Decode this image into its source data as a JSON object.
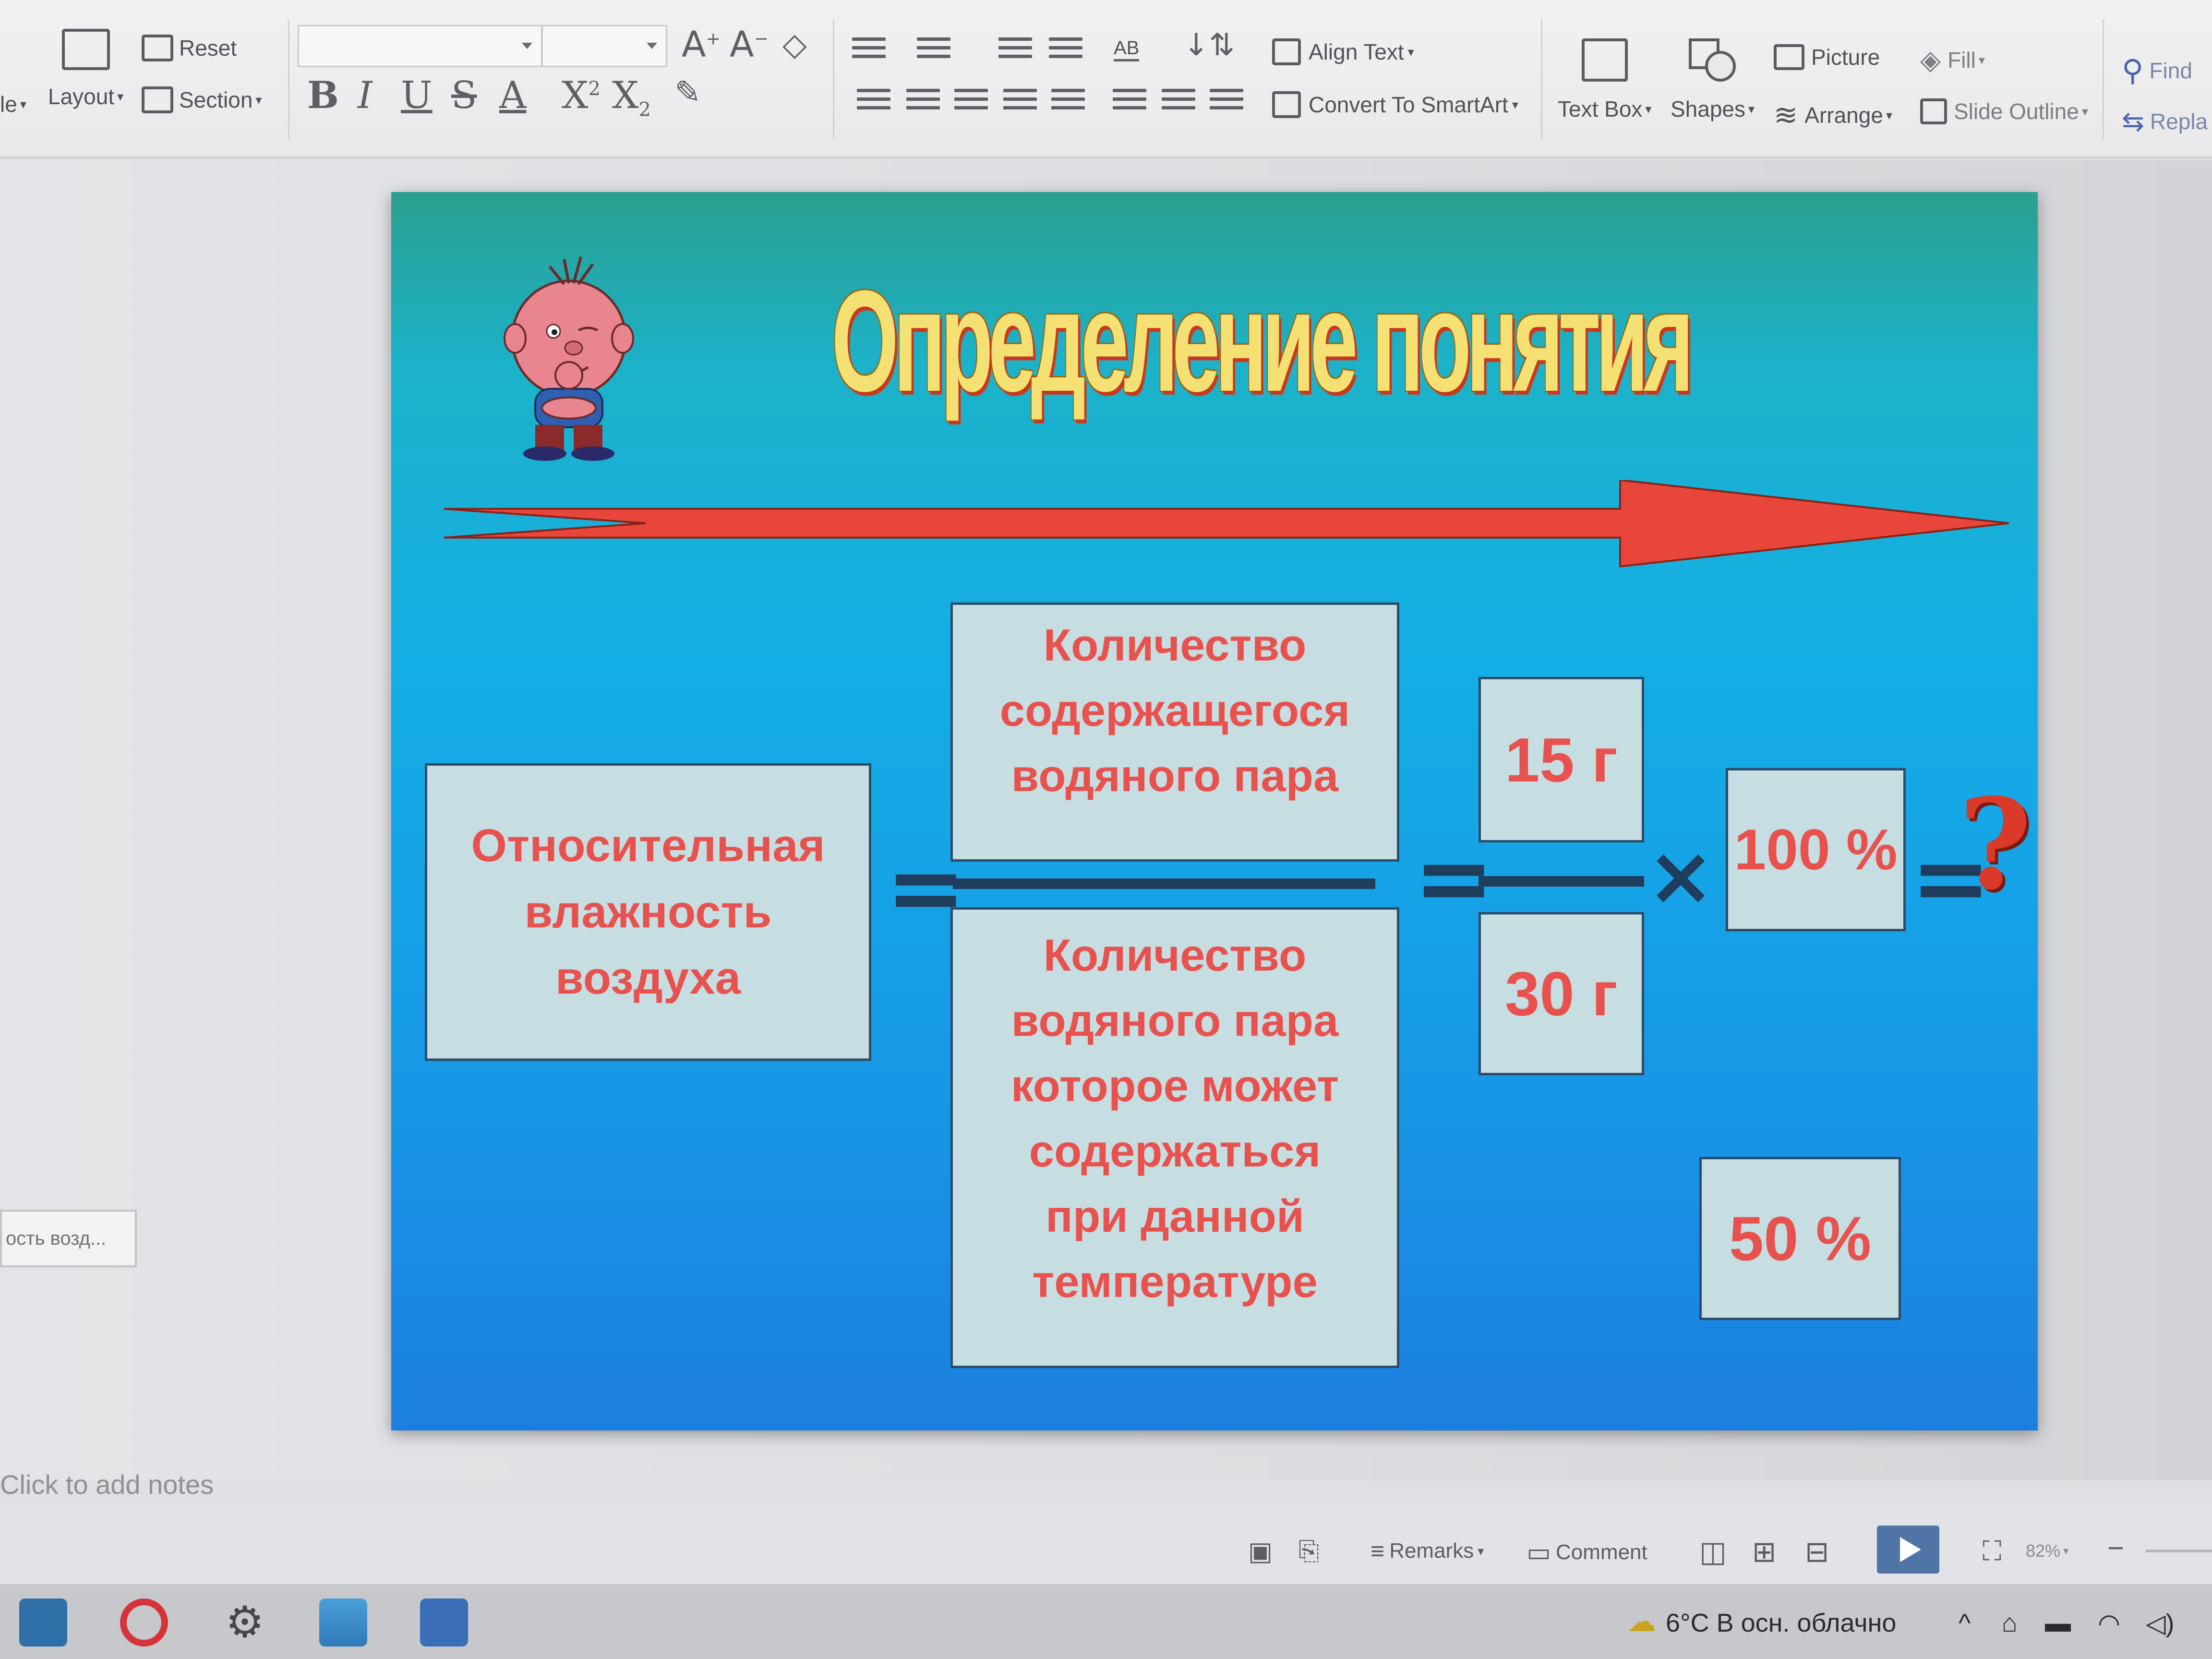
{
  "ribbon": {
    "layout_label": "Layout",
    "reset_label": "Reset",
    "section_label": "Section",
    "truncated_left_label": "le",
    "font_name_value": "",
    "font_size_value": "",
    "align_text_label": "Align Text",
    "convert_smartart_label": "Convert To SmartArt",
    "text_box_label": "Text Box",
    "shapes_label": "Shapes",
    "picture_label": "Picture",
    "arrange_label": "Arrange",
    "fill_label": "Fill",
    "slide_outline_label": "Slide Outline",
    "find_label": "Find",
    "replace_label": "Repla",
    "ab_label": "AB"
  },
  "slide": {
    "title": "Определение понятия",
    "left_box": "Относительная\nвлажность\nвоздуха",
    "numerator_box": "Количество\nсодержащегося\nводяного пара",
    "denominator_box": "Количество\nводяного пара\nкоторое может\nсодержаться\nпри данной\nтемпературе",
    "value_15": "15 г",
    "value_30": "30 г",
    "value_100": "100 %",
    "value_50": "50 %",
    "question": "?",
    "equals": "=",
    "times": "×"
  },
  "workspace": {
    "thumbnail_label": "ость возд...",
    "notes_placeholder": "Click to add notes"
  },
  "statusbar": {
    "remarks_label": "Remarks",
    "comment_label": "Comment",
    "zoom_value": "82%"
  },
  "taskbar": {
    "weather": "6°C  В осн. облачно"
  },
  "colors": {
    "slide_top": "#2aa08f",
    "slide_bottom": "#1c7fe0",
    "title_fill": "#f5e173",
    "box_fill": "#c6dee2",
    "box_text": "#e8524e",
    "arrow": "#e8463a",
    "operator": "#1f3d5c"
  }
}
